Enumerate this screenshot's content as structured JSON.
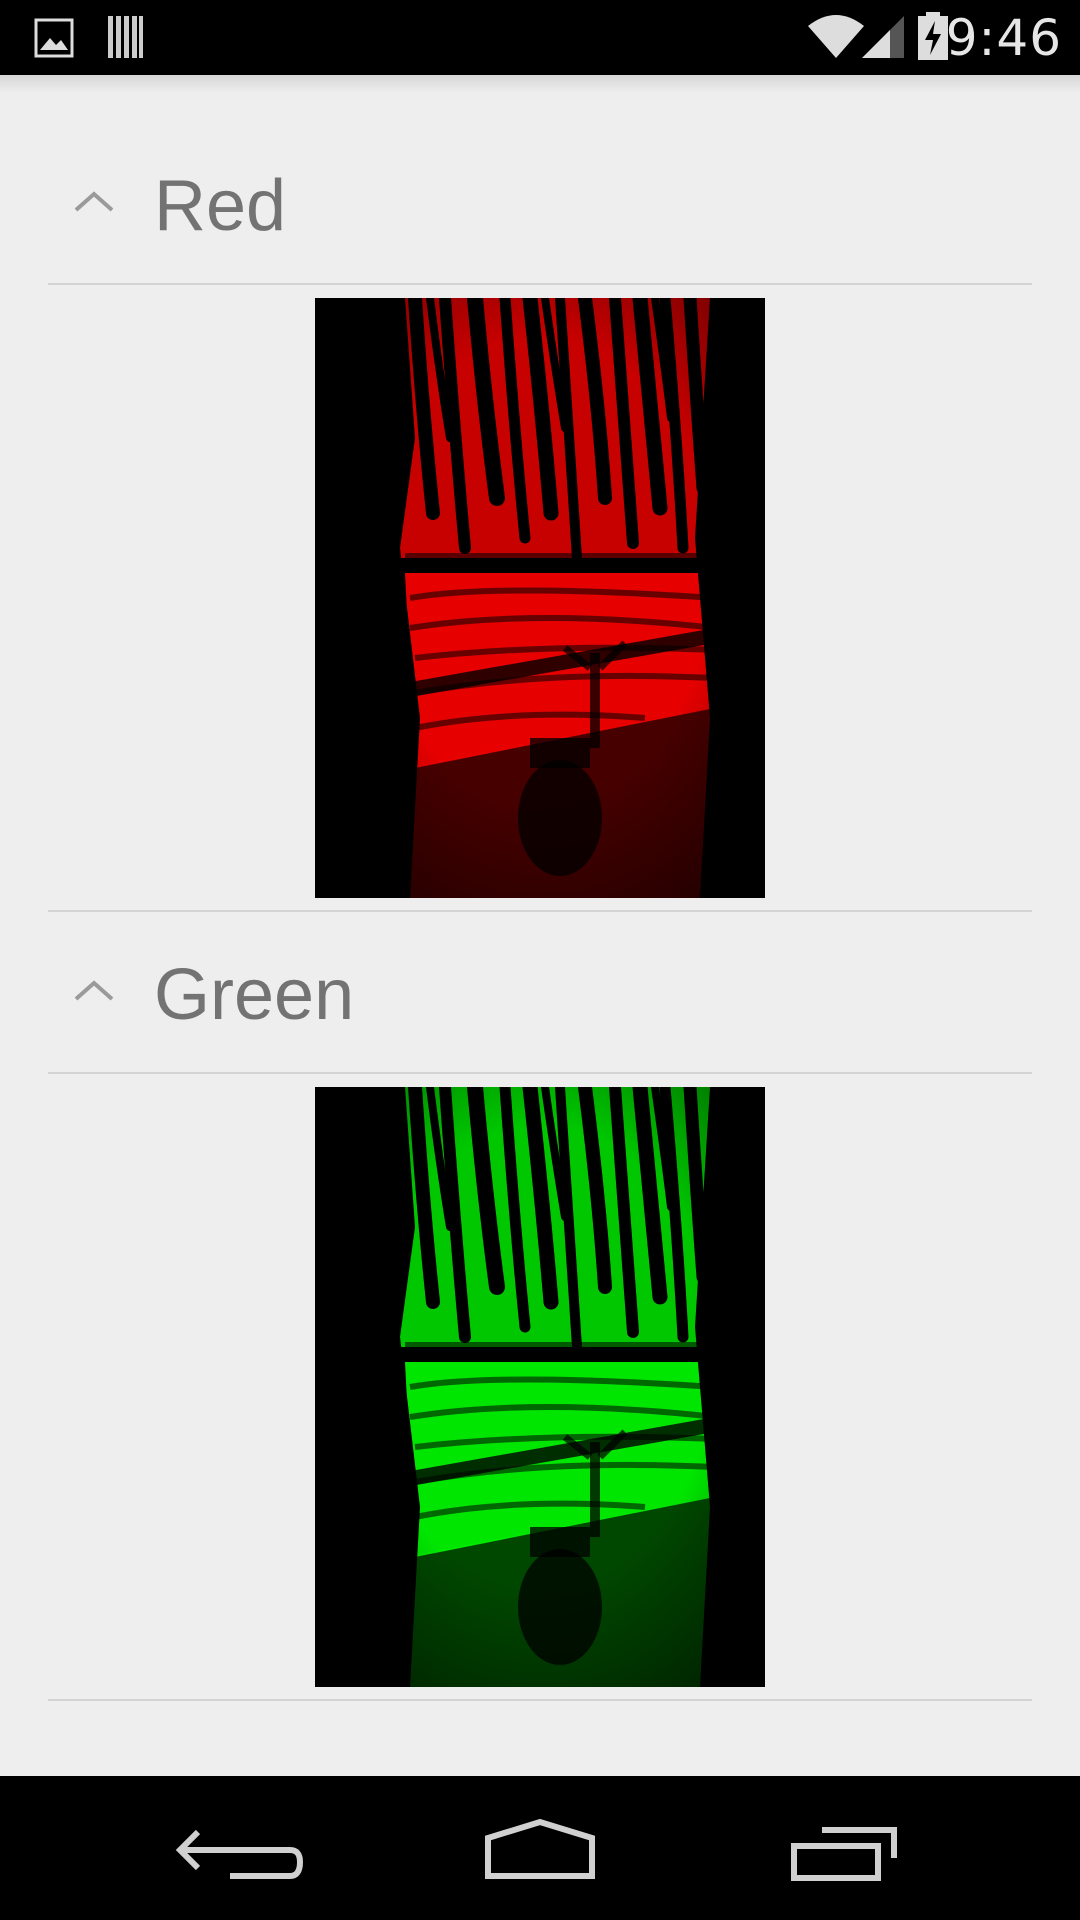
{
  "status_bar": {
    "time": "9:46",
    "icons": [
      "image-icon",
      "barcode-icon",
      "wifi-icon",
      "signal-icon",
      "battery-charging-icon"
    ]
  },
  "sections": [
    {
      "title": "Red",
      "expanded": true,
      "tint": "#ff0000",
      "image": "red-channel-photo"
    },
    {
      "title": "Green",
      "expanded": true,
      "tint": "#00ff00",
      "image": "green-channel-photo"
    }
  ],
  "nav_bar": {
    "buttons": [
      "back-icon",
      "home-icon",
      "recents-icon"
    ]
  }
}
